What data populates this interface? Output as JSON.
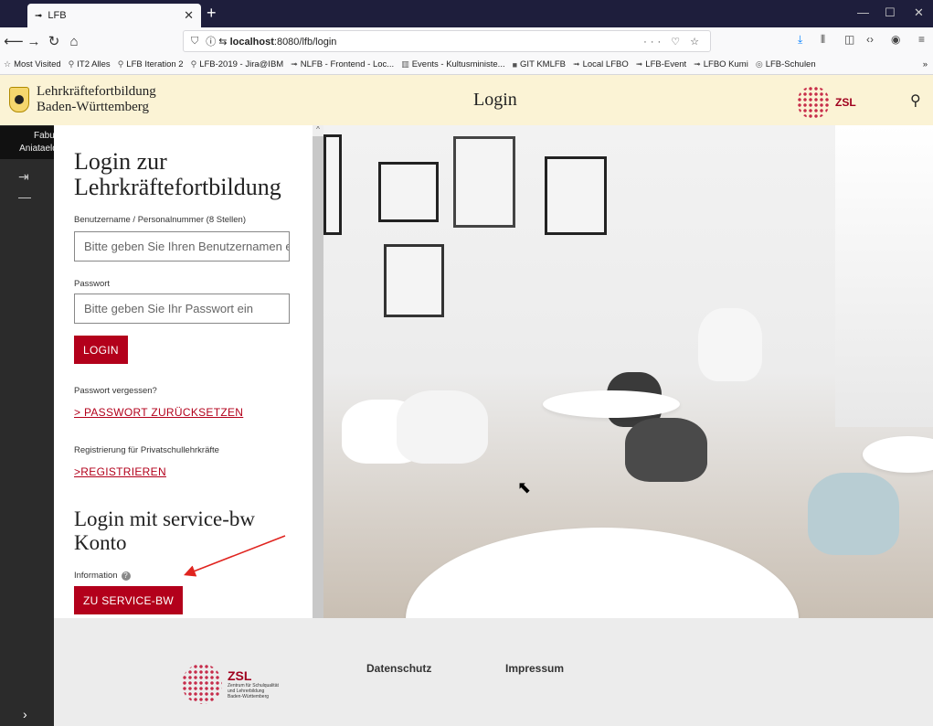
{
  "browser": {
    "tab_title": "LFB",
    "tab_favicon": "➟",
    "url_prefix": "ⓘ ⇆ ",
    "url_host": "localhost",
    "url_path": ":8080/lfb/login",
    "bookmarks": [
      {
        "label": "Most Visited",
        "icon": "☆"
      },
      {
        "label": "IT2 Alles",
        "icon": "⚲"
      },
      {
        "label": "LFB Iteration 2",
        "icon": "⚲"
      },
      {
        "label": "LFB-2019 - Jira@IBM",
        "icon": "⚲"
      },
      {
        "label": "NLFB - Frontend - Loc...",
        "icon": "➟"
      },
      {
        "label": "Events - Kultusministe...",
        "icon": "▥"
      },
      {
        "label": "GIT KMLFB",
        "icon": "■"
      },
      {
        "label": "Local LFBO",
        "icon": "➟"
      },
      {
        "label": "LFB-Event",
        "icon": "➟"
      },
      {
        "label": "LFBO Kumi",
        "icon": "➟"
      },
      {
        "label": "LFB-Schulen",
        "icon": "◎"
      }
    ],
    "bookmarks_more": "»"
  },
  "header": {
    "brand_line1": "Lehrkräftefortbildung",
    "brand_line2": "Baden-Württemberg",
    "title": "Login",
    "zsl": "ZSL"
  },
  "sidebar": {
    "tooltip_line1": "Fabugusnulius",
    "tooltip_line2": "Aniataeldultenthernes"
  },
  "login": {
    "heading_line1": "Login zur",
    "heading_line2": "Lehrkräftefortbildung",
    "username_label": "Benutzername / Personalnummer (8 Stellen)",
    "username_placeholder": "Bitte geben Sie Ihren Benutzernamen ein",
    "password_label": "Passwort",
    "password_placeholder": "Bitte geben Sie Ihr Passwort ein",
    "login_button": "LOGIN",
    "forgot_label": "Passwort vergessen?",
    "reset_link": "> PASSWORT ZURÜCKSETZEN",
    "register_label": "Registrierung für Privatschullehrkräfte",
    "register_link": ">REGISTRIEREN",
    "servicebw_heading_line1": "Login mit service-bw",
    "servicebw_heading_line2": "Konto",
    "info_label": "Information",
    "servicebw_button": "ZU SERVICE-BW"
  },
  "footer": {
    "zsl_name": "ZSL",
    "zsl_sub1": "Zentrum für Schulqualität",
    "zsl_sub2": "und Lehrerbildung",
    "zsl_sub3": "Baden-Württemberg",
    "datenschutz": "Datenschutz",
    "impressum": "Impressum"
  },
  "colors": {
    "accent_red": "#b3001b",
    "header_bg": "#fbf3d5",
    "sidebar_bg": "#2b2b2b"
  }
}
